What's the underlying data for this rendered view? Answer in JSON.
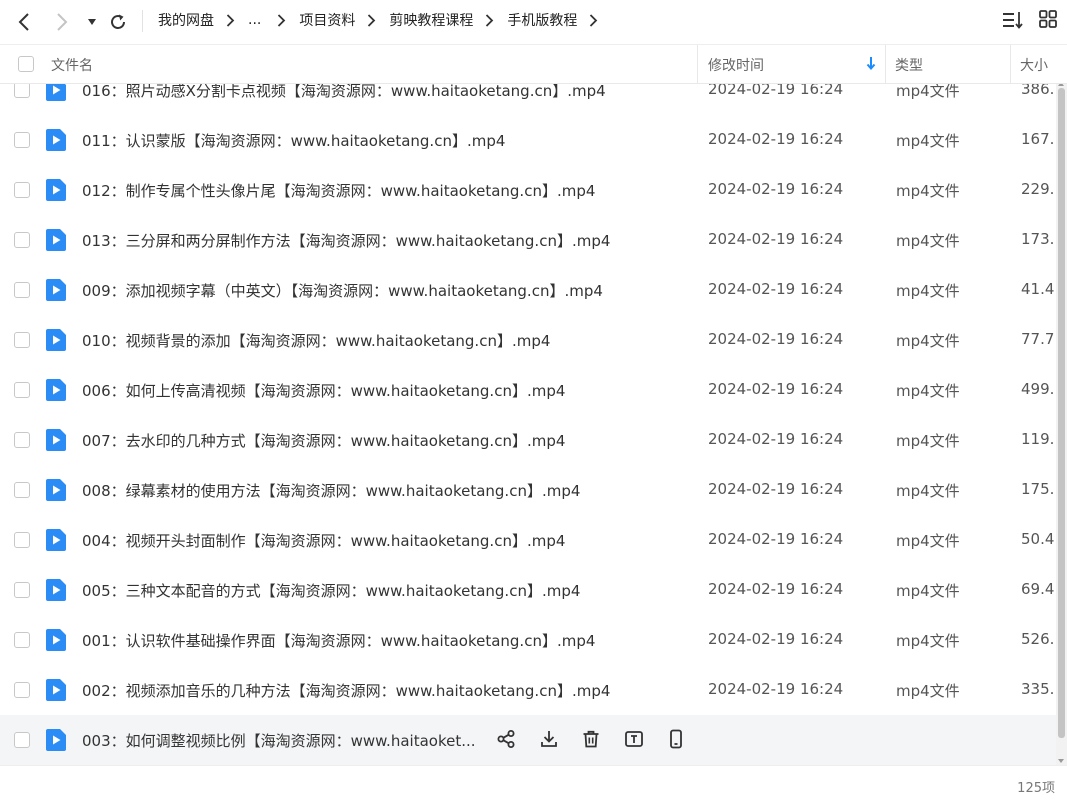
{
  "toolbar": {
    "back_icon": "chevron-left-icon",
    "forward_icon": "chevron-right-icon",
    "history_icon": "caret-down-icon",
    "refresh_icon": "refresh-icon",
    "sort_icon": "sort-list-icon",
    "grid_icon": "grid-view-icon"
  },
  "breadcrumb": [
    "我的网盘",
    "...",
    "项目资料",
    "剪映教程课程",
    "手机版教程"
  ],
  "columns": {
    "name": "文件名",
    "modified": "修改时间",
    "type": "类型",
    "size": "大小"
  },
  "files": [
    {
      "name": "016：照片动感X分割卡点视频【海淘资源网：www.haitaoketang.cn】.mp4",
      "date": "2024-02-19 16:24",
      "type": "mp4文件",
      "size": "386."
    },
    {
      "name": "011：认识蒙版【海淘资源网：www.haitaoketang.cn】.mp4",
      "date": "2024-02-19 16:24",
      "type": "mp4文件",
      "size": "167."
    },
    {
      "name": "012：制作专属个性头像片尾【海淘资源网：www.haitaoketang.cn】.mp4",
      "date": "2024-02-19 16:24",
      "type": "mp4文件",
      "size": "229."
    },
    {
      "name": "013：三分屏和两分屏制作方法【海淘资源网：www.haitaoketang.cn】.mp4",
      "date": "2024-02-19 16:24",
      "type": "mp4文件",
      "size": "173."
    },
    {
      "name": "009：添加视频字幕（中英文）【海淘资源网：www.haitaoketang.cn】.mp4",
      "date": "2024-02-19 16:24",
      "type": "mp4文件",
      "size": "41.4"
    },
    {
      "name": "010：视频背景的添加【海淘资源网：www.haitaoketang.cn】.mp4",
      "date": "2024-02-19 16:24",
      "type": "mp4文件",
      "size": "77.7"
    },
    {
      "name": "006：如何上传高清视频【海淘资源网：www.haitaoketang.cn】.mp4",
      "date": "2024-02-19 16:24",
      "type": "mp4文件",
      "size": "499."
    },
    {
      "name": "007：去水印的几种方式【海淘资源网：www.haitaoketang.cn】.mp4",
      "date": "2024-02-19 16:24",
      "type": "mp4文件",
      "size": "119."
    },
    {
      "name": "008：绿幕素材的使用方法【海淘资源网：www.haitaoketang.cn】.mp4",
      "date": "2024-02-19 16:24",
      "type": "mp4文件",
      "size": "175."
    },
    {
      "name": "004：视频开头封面制作【海淘资源网：www.haitaoketang.cn】.mp4",
      "date": "2024-02-19 16:24",
      "type": "mp4文件",
      "size": "50.4"
    },
    {
      "name": "005：三种文本配音的方式【海淘资源网：www.haitaoketang.cn】.mp4",
      "date": "2024-02-19 16:24",
      "type": "mp4文件",
      "size": "69.4"
    },
    {
      "name": "001：认识软件基础操作界面【海淘资源网：www.haitaoketang.cn】.mp4",
      "date": "2024-02-19 16:24",
      "type": "mp4文件",
      "size": "526."
    },
    {
      "name": "002：视频添加音乐的几种方法【海淘资源网：www.haitaoketang.cn】.mp4",
      "date": "2024-02-19 16:24",
      "type": "mp4文件",
      "size": "335."
    },
    {
      "name": "003：如何调整视频比例【海淘资源网：www.haitaoket...",
      "date": "",
      "type": "",
      "size": "",
      "hover": true
    }
  ],
  "row_actions": [
    "share-icon",
    "download-icon",
    "trash-icon",
    "rename-icon",
    "phone-icon"
  ],
  "footer": {
    "count": "125项"
  },
  "colors": {
    "accent": "#1a8cff",
    "file_icon": "#2b8cf6",
    "hover_row": "#f4f5f7"
  }
}
